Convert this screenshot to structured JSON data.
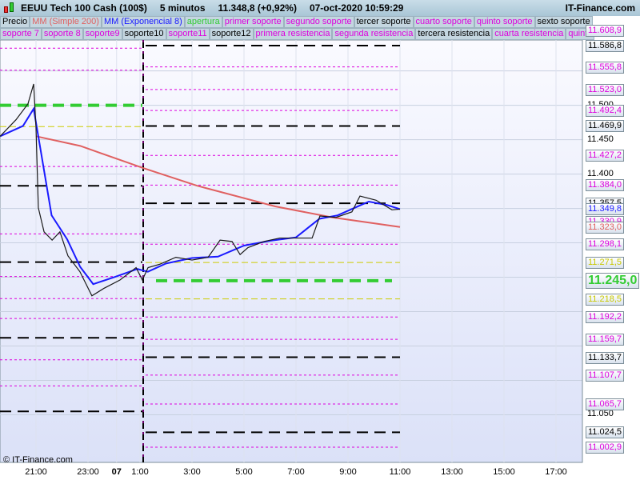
{
  "header": {
    "title": "EEUU Tech 100 Cash (100$)",
    "timeframe": "5 minutos",
    "price": "11.348,8 (+0,92%)",
    "datetime": "07-oct-2020 10:59:29",
    "brand": "IT-Finance.com"
  },
  "legend_row1": [
    {
      "label": "Precio",
      "color": "#000000"
    },
    {
      "label": "MM (Simple 200)",
      "color": "#e06060"
    },
    {
      "label": "MM (Exponencial 8)",
      "color": "#1a1aff"
    },
    {
      "label": "apertura",
      "color": "#33cc33"
    },
    {
      "label": "primer soporte",
      "color": "#dd00dd"
    },
    {
      "label": "segundo soporte",
      "color": "#dd00dd"
    },
    {
      "label": "tercer soporte",
      "color": "#000000"
    },
    {
      "label": "cuarto soporte",
      "color": "#dd00dd"
    },
    {
      "label": "quinto soporte",
      "color": "#dd00dd"
    },
    {
      "label": "sexto soporte",
      "color": "#000000"
    }
  ],
  "legend_row2": [
    {
      "label": "soporte 7",
      "color": "#dd00dd"
    },
    {
      "label": "soporte 8",
      "color": "#dd00dd"
    },
    {
      "label": "soporte9",
      "color": "#dd00dd"
    },
    {
      "label": "soporte10",
      "color": "#000000"
    },
    {
      "label": "soporte11",
      "color": "#dd00dd"
    },
    {
      "label": "soporte12",
      "color": "#000000"
    },
    {
      "label": "primera resistencia",
      "color": "#dd00dd"
    },
    {
      "label": "segunda resistencia",
      "color": "#dd00dd"
    },
    {
      "label": "tercera resistencia",
      "color": "#000000"
    },
    {
      "label": "cuarta resistencia",
      "color": "#dd00dd"
    },
    {
      "label": "quinta",
      "color": "#dd00dd"
    }
  ],
  "copyright": "© IT-Finance.com",
  "chart_data": {
    "type": "line",
    "x_unit": "hours since 06-oct 21:00",
    "xlim": [
      -1.38,
      21.5
    ],
    "ylim": [
      11002.9,
      11608.9
    ],
    "x_ticks": [
      {
        "x": 0,
        "label": "21:00"
      },
      {
        "x": 2,
        "label": "23:00"
      },
      {
        "x": 3.1,
        "label": "07"
      },
      {
        "x": 4,
        "label": "1:00"
      },
      {
        "x": 6,
        "label": "3:00"
      },
      {
        "x": 8,
        "label": "5:00"
      },
      {
        "x": 10,
        "label": "7:00"
      },
      {
        "x": 12,
        "label": "9:00"
      },
      {
        "x": 14,
        "label": "11:00"
      },
      {
        "x": 16,
        "label": "13:00"
      },
      {
        "x": 18,
        "label": "15:00"
      },
      {
        "x": 20,
        "label": "17:00"
      }
    ],
    "y_ticks": [
      "11.500",
      "11.450",
      "11.400",
      "11.050"
    ],
    "y_tick_values": [
      11500,
      11450,
      11400,
      11050
    ],
    "series": [
      {
        "name": "Precio",
        "color": "#1a1a1a",
        "x": [
          -1.38,
          -0.77,
          -0.31,
          -0.09,
          0,
          0.09,
          0.31,
          0.62,
          0.92,
          1.23,
          1.69,
          2.15,
          2.62,
          3.23,
          3.85,
          4.09,
          4.31,
          4.77,
          5.38,
          6,
          6.62,
          7.08,
          7.54,
          7.85,
          8.15,
          8.77,
          9.38,
          10,
          10.62,
          10.92,
          11.54,
          12.15,
          12.46,
          13.08,
          13.69,
          14
        ],
        "y": [
          11455,
          11479,
          11502,
          11531,
          11467,
          11351,
          11316,
          11304,
          11316,
          11281,
          11258,
          11223,
          11234,
          11246,
          11264,
          11246,
          11264,
          11269,
          11279,
          11275,
          11279,
          11304,
          11302,
          11283,
          11293,
          11302,
          11307,
          11307,
          11307,
          11339,
          11337,
          11345,
          11368,
          11362,
          11348,
          11349
        ]
      },
      {
        "name": "MM (Exponencial 8)",
        "color": "#1a1aff",
        "x": [
          -1.38,
          -0.5,
          -0.09,
          0.2,
          0.6,
          1.2,
          1.7,
          2.2,
          3,
          3.9,
          4.3,
          5,
          6,
          7,
          8,
          9,
          10,
          10.9,
          11.6,
          12.2,
          12.8,
          13.5,
          14
        ],
        "y": [
          11455,
          11470,
          11495,
          11430,
          11340,
          11305,
          11265,
          11240,
          11250,
          11262,
          11258,
          11270,
          11278,
          11280,
          11296,
          11303,
          11308,
          11335,
          11340,
          11350,
          11360,
          11355,
          11349
        ]
      },
      {
        "name": "MM (Simple 200)",
        "color": "#e06060",
        "x": [
          0,
          1.7,
          4.1,
          6.2,
          9.2,
          11.4,
          14
        ],
        "y": [
          11455,
          11441,
          11409,
          11383,
          11353,
          11337,
          11323
        ]
      }
    ],
    "levels_previous": [
      {
        "price": 11583,
        "color": "#dd00dd",
        "style": "dot"
      },
      {
        "price": 11551,
        "color": "#dd00dd",
        "style": "dot"
      },
      {
        "price": 11500,
        "color": "#33cc33",
        "style": "thick"
      },
      {
        "price": 11469,
        "color": "#cccc00",
        "style": "dash"
      },
      {
        "price": 11411,
        "color": "#dd00dd",
        "style": "dot"
      },
      {
        "price": 11383,
        "color": "#000000",
        "style": "long"
      },
      {
        "price": 11313,
        "color": "#dd00dd",
        "style": "dot"
      },
      {
        "price": 11272,
        "color": "#000000",
        "style": "long"
      },
      {
        "price": 11251,
        "color": "#dd00dd",
        "style": "dot"
      },
      {
        "price": 11219,
        "color": "#dd00dd",
        "style": "dot"
      },
      {
        "price": 11190,
        "color": "#dd00dd",
        "style": "dot"
      },
      {
        "price": 11162,
        "color": "#000000",
        "style": "long"
      },
      {
        "price": 11130,
        "color": "#dd00dd",
        "style": "dot"
      },
      {
        "price": 11092,
        "color": "#dd00dd",
        "style": "dot"
      },
      {
        "price": 11055,
        "color": "#000000",
        "style": "long"
      }
    ],
    "levels_current": [
      {
        "price": 11608.9,
        "label": "11.608,9",
        "color": "#dd00dd",
        "style": "dot"
      },
      {
        "price": 11586.8,
        "label": "11.586,8",
        "color": "#000000",
        "style": "long"
      },
      {
        "price": 11555.8,
        "label": "11.555,8",
        "color": "#dd00dd",
        "style": "dot"
      },
      {
        "price": 11523.0,
        "label": "11.523,0",
        "color": "#dd00dd",
        "style": "dot"
      },
      {
        "price": 11492.4,
        "label": "11.492,4",
        "color": "#dd00dd",
        "style": "dot"
      },
      {
        "price": 11469.9,
        "label": "11.469,9",
        "color": "#000000",
        "style": "long"
      },
      {
        "price": 11427.2,
        "label": "11.427,2",
        "color": "#dd00dd",
        "style": "dot"
      },
      {
        "price": 11384.0,
        "label": "11.384,0",
        "color": "#dd00dd",
        "style": "dot"
      },
      {
        "price": 11357.5,
        "label": "11.357,5",
        "color": "#000000",
        "style": "long"
      },
      {
        "price": 11349.8,
        "label": "11.349,8",
        "color": "#1a1aff",
        "style": "none"
      },
      {
        "price": 11330.9,
        "label": "11.330,9",
        "color": "#dd00dd",
        "style": "none"
      },
      {
        "price": 11323.0,
        "label": "11.323,0",
        "color": "#e06060",
        "style": "none"
      },
      {
        "price": 11298.1,
        "label": "11.298,1",
        "color": "#dd00dd",
        "style": "dot"
      },
      {
        "price": 11271.5,
        "label": "11.271,5",
        "color": "#cccc00",
        "style": "dash"
      },
      {
        "price": 11245.0,
        "label": "11.245,0",
        "color": "#33cc33",
        "style": "thick"
      },
      {
        "price": 11218.5,
        "label": "11.218,5",
        "color": "#cccc00",
        "style": "dash"
      },
      {
        "price": 11192.2,
        "label": "11.192,2",
        "color": "#dd00dd",
        "style": "dot"
      },
      {
        "price": 11159.7,
        "label": "11.159,7",
        "color": "#dd00dd",
        "style": "dot"
      },
      {
        "price": 11133.7,
        "label": "11.133,7",
        "color": "#000000",
        "style": "long"
      },
      {
        "price": 11107.7,
        "label": "11.107,7",
        "color": "#dd00dd",
        "style": "dot"
      },
      {
        "price": 11065.7,
        "label": "11.065,7",
        "color": "#dd00dd",
        "style": "dot"
      },
      {
        "price": 11024.5,
        "label": "11.024,5",
        "color": "#000000",
        "style": "long"
      },
      {
        "price": 11002.9,
        "label": "11.002,9",
        "color": "#dd00dd",
        "style": "dot"
      }
    ]
  }
}
